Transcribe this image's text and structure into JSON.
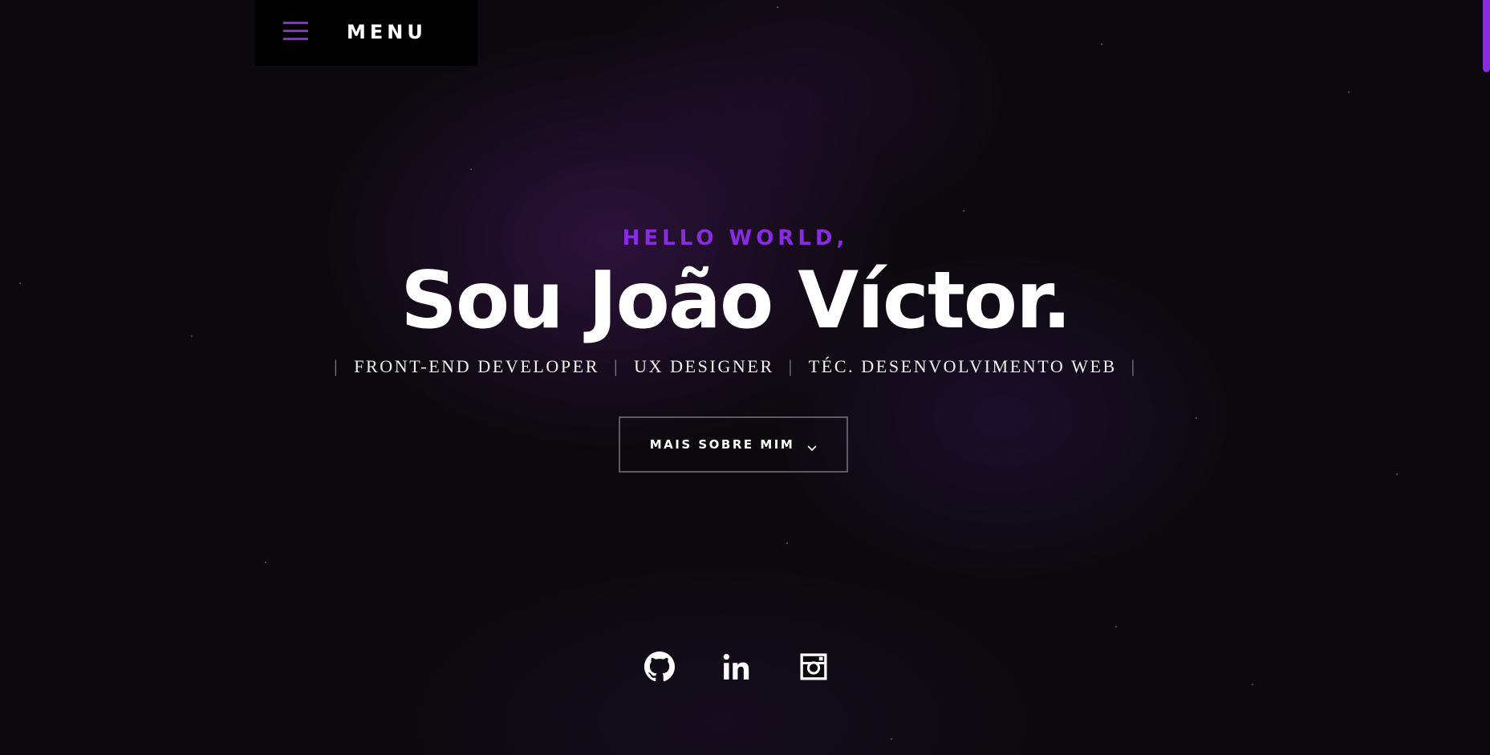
{
  "menu": {
    "label": "MENU",
    "icon": "hamburger-icon"
  },
  "hero": {
    "greeting": "HELLO WORLD,",
    "name": "Sou João Víctor.",
    "roles": [
      "FRONT-END DEVELOPER",
      "UX DESIGNER",
      "TÉC. DESENVOLVIMENTO WEB"
    ],
    "separator": "|",
    "cta_label": "MAIS SOBRE MIM",
    "cta_icon": "chevron-down-icon"
  },
  "social": [
    {
      "name": "github",
      "icon": "github-icon"
    },
    {
      "name": "linkedin",
      "icon": "linkedin-icon"
    },
    {
      "name": "instagram",
      "icon": "instagram-icon"
    }
  ],
  "colors": {
    "accent": "#8a2be2",
    "background": "#0b090d",
    "text": "#ffffff",
    "button_border": "#5e5a64"
  }
}
